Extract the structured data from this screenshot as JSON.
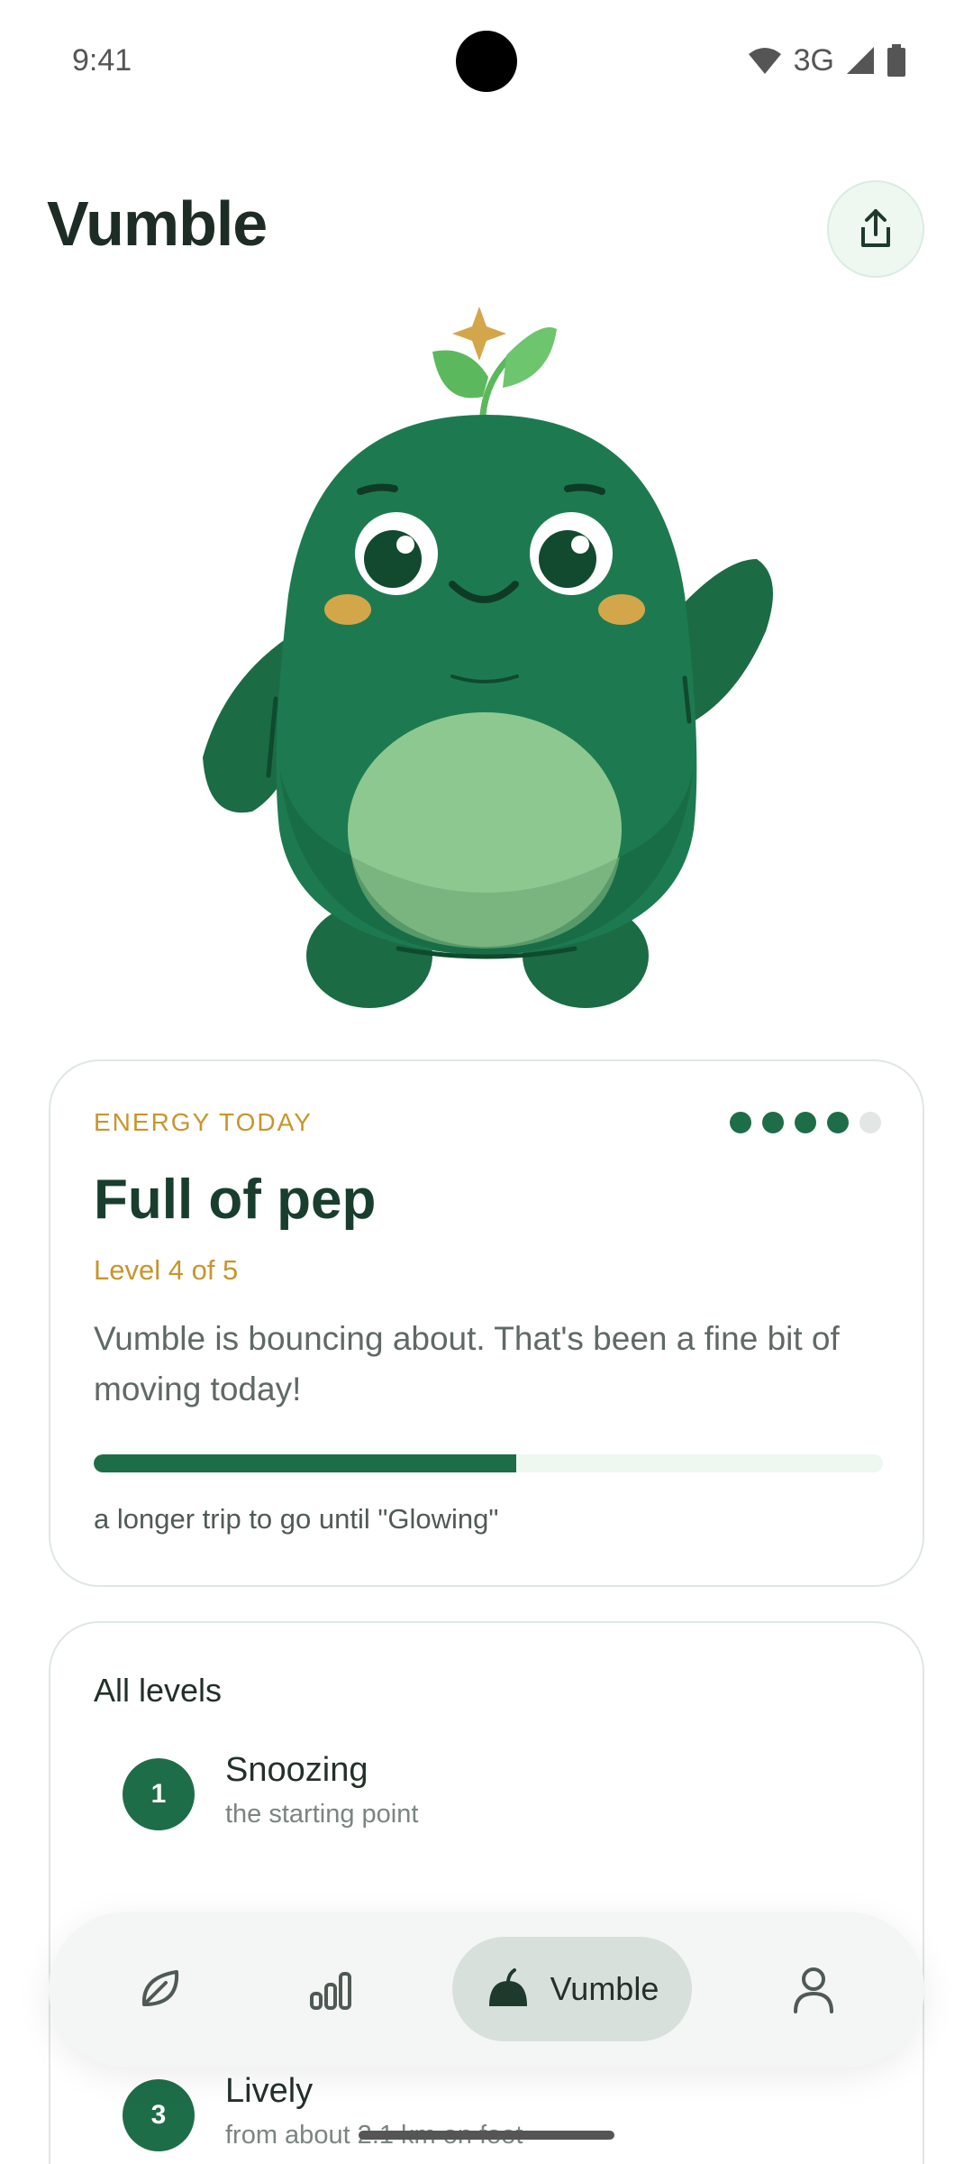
{
  "status_bar": {
    "time": "9:41",
    "network": "3G"
  },
  "header": {
    "title": "Vumble",
    "share_icon": "share-icon"
  },
  "energy_card": {
    "eyebrow": "ENERGY TODAY",
    "level_dots": {
      "filled": 4,
      "total": 5
    },
    "heading": "Full of pep",
    "level_text": "Level 4 of 5",
    "description": "Vumble is bouncing about. That's been a fine bit of moving today!",
    "progress_fraction": 0.535,
    "progress_note": "a longer trip to go until \"Glowing\"",
    "accent_color": "#1e6d49",
    "gold_color": "#c8952c"
  },
  "levels_card": {
    "title": "All levels",
    "items": [
      {
        "number": "1",
        "name": "Snoozing",
        "subtitle": "the starting point"
      },
      {
        "number": "3",
        "name": "Lively",
        "subtitle": "from about 2.1 km on foot"
      }
    ]
  },
  "bottom_nav": {
    "items": [
      {
        "icon": "leaf-icon",
        "label": ""
      },
      {
        "icon": "bar-chart-icon",
        "label": ""
      },
      {
        "icon": "sprout-icon",
        "label": "Vumble",
        "active": true
      },
      {
        "icon": "person-icon",
        "label": ""
      }
    ]
  }
}
